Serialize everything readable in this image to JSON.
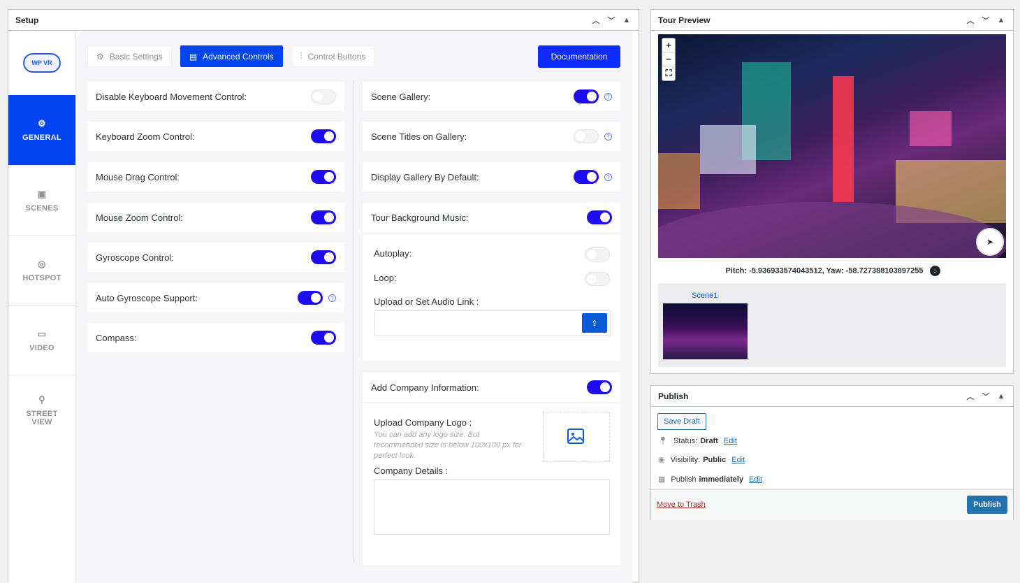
{
  "setup": {
    "title": "Setup",
    "logo_text": "WP VR",
    "nav": [
      {
        "label": "GENERAL",
        "icon": "gear-icon"
      },
      {
        "label": "SCENES",
        "icon": "image-icon"
      },
      {
        "label": "HOTSPOT",
        "icon": "target-icon"
      },
      {
        "label": "VIDEO",
        "icon": "video-icon"
      },
      {
        "label": "STREET VIEW",
        "icon": "pin-icon"
      }
    ],
    "tabs": {
      "basic": "Basic Settings",
      "advanced": "Advanced Controls",
      "control": "Control Buttons"
    },
    "documentation": "Documentation",
    "left_settings": [
      {
        "label": "Disable Keyboard Movement Control:",
        "on": false
      },
      {
        "label": "Keyboard Zoom Control:",
        "on": true
      },
      {
        "label": "Mouse Drag Control:",
        "on": true
      },
      {
        "label": "Mouse Zoom Control:",
        "on": true
      },
      {
        "label": "Gyroscope Control:",
        "on": true
      },
      {
        "label": "Auto Gyroscope Support:",
        "on": true
      },
      {
        "label": "Compass:",
        "on": true
      }
    ],
    "right_settings": [
      {
        "label": "Scene Gallery:",
        "on": true
      },
      {
        "label": "Scene Titles on Gallery:",
        "on": false
      },
      {
        "label": "Display Gallery By Default:",
        "on": true
      },
      {
        "label": "Tour Background Music:",
        "on": true
      }
    ],
    "music": {
      "autoplay": "Autoplay:",
      "loop": "Loop:",
      "audio_link_label": "Upload or Set Audio Link :",
      "audio_link_value": ""
    },
    "company": {
      "label": "Add Company Information:",
      "logo_label": "Upload Company Logo :",
      "logo_hint": "You can add any logo size. But recommended size is below 100x100 px for perfect look.",
      "details_label": "Company Details :",
      "details_value": ""
    }
  },
  "tour_preview": {
    "title": "Tour Preview",
    "zoom_in": "+",
    "zoom_out": "−",
    "pitch_yaw": "Pitch: -5.936933574043512, Yaw: -58.727388103897255",
    "scene_name": "Scene1"
  },
  "publish": {
    "title": "Publish",
    "save_draft": "Save Draft",
    "status_label": "Status:",
    "status_value": "Draft",
    "visibility_label": "Visibility:",
    "visibility_value": "Public",
    "publish_label": "Publish",
    "publish_value": "immediately",
    "edit": "Edit",
    "move_to_trash": "Move to Trash",
    "publish_button": "Publish"
  },
  "colors": {
    "accent": "#0043f0",
    "toggle_on": "#1e0cf0",
    "wp_blue": "#2271b1"
  }
}
